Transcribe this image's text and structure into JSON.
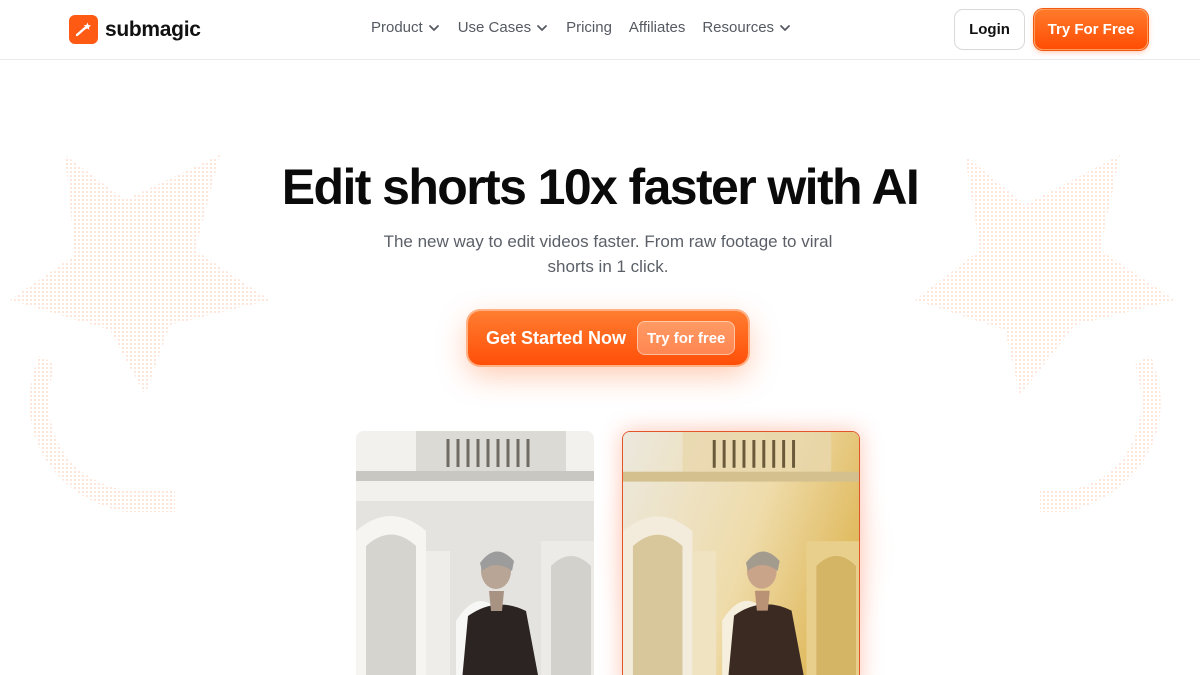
{
  "brand": {
    "name": "submagic",
    "accent": "#ff5a14"
  },
  "nav": {
    "items": [
      {
        "label": "Product",
        "dropdown": true
      },
      {
        "label": "Use Cases",
        "dropdown": true
      },
      {
        "label": "Pricing",
        "dropdown": false
      },
      {
        "label": "Affiliates",
        "dropdown": false
      },
      {
        "label": "Resources",
        "dropdown": true
      }
    ],
    "login_label": "Login",
    "try_label": "Try For Free"
  },
  "hero": {
    "title": "Edit shorts 10x faster with AI",
    "subtitle": "The new way to edit videos faster. From raw footage to viral shorts in 1 click.",
    "cta_label": "Get Started Now",
    "cta_pill": "Try for free"
  },
  "videos": [
    {
      "variant": "original",
      "tint": "neutral"
    },
    {
      "variant": "edited",
      "tint": "warm"
    }
  ]
}
